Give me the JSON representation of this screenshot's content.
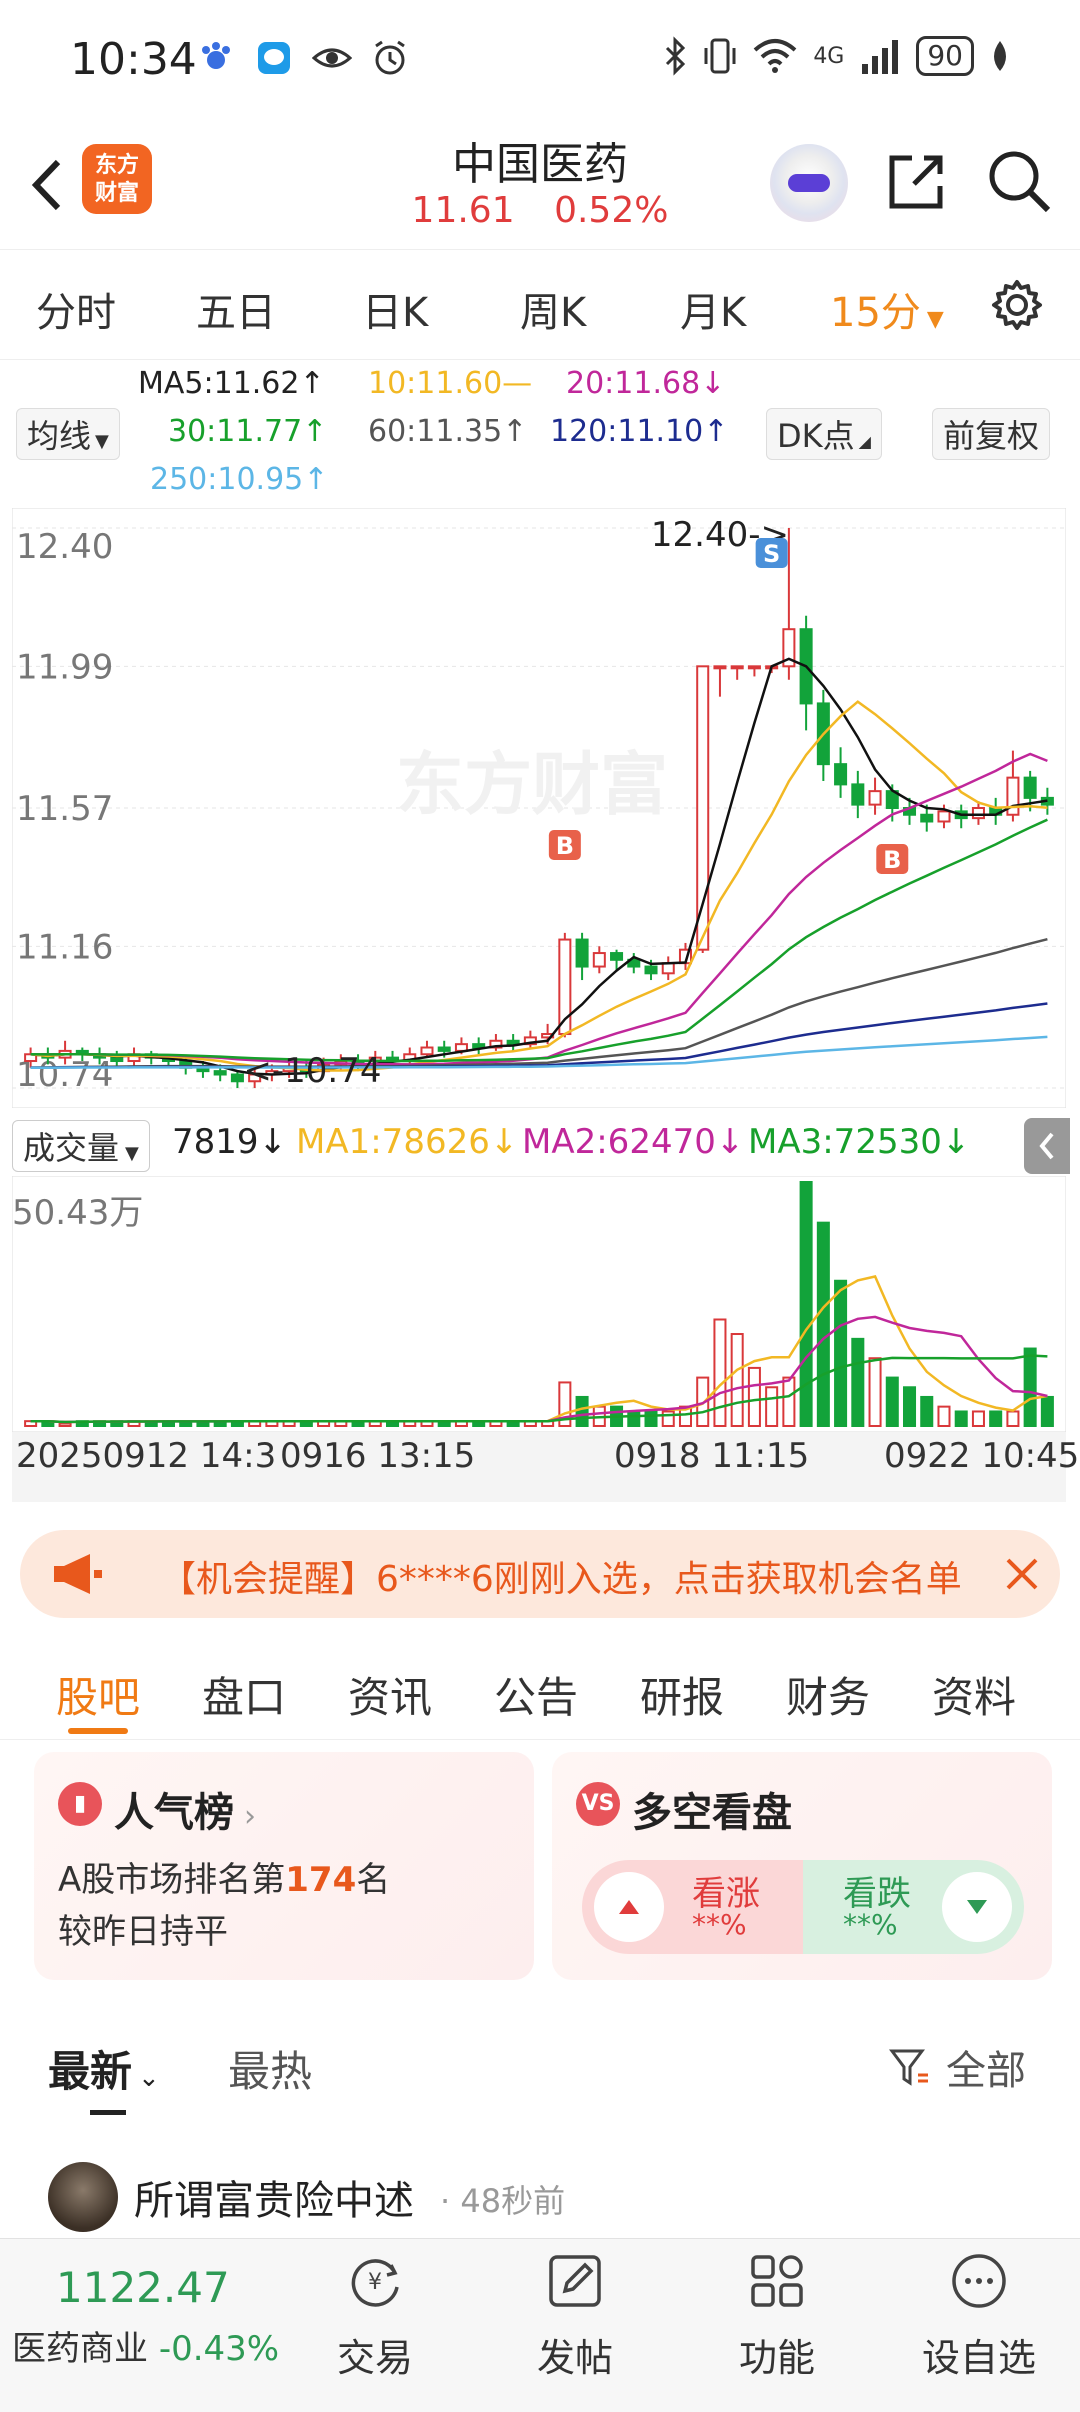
{
  "status_bar": {
    "time": "10:34",
    "network": "4G",
    "battery": "90"
  },
  "header": {
    "logo_text_top": "东方",
    "logo_text_bottom": "财富",
    "stock_name": "中国医药",
    "price": "11.61",
    "change_pct": "0.52%"
  },
  "period_tabs": [
    {
      "label": "分时"
    },
    {
      "label": "五日"
    },
    {
      "label": "日K"
    },
    {
      "label": "周K"
    },
    {
      "label": "月K"
    },
    {
      "label": "15分",
      "active": true
    }
  ],
  "ma_legend": {
    "indicator_select": "均线",
    "ma5": "MA5:11.62↑",
    "ma10": "10:11.60—",
    "ma20": "20:11.68↓",
    "ma30": "30:11.77↑",
    "ma60": "60:11.35↑",
    "ma120": "120:11.10↑",
    "ma250": "250:10.95↑",
    "dk_button": "DK点",
    "adjust_button": "前复权"
  },
  "chart_data": {
    "type": "candlestick",
    "watermark": "东方财富",
    "y_ticks": [
      "12.40",
      "11.99",
      "11.57",
      "11.16",
      "10.74"
    ],
    "ylim": [
      10.74,
      12.4
    ],
    "high_label": "12.40->",
    "low_label": "<-10.74",
    "markers": [
      "S",
      "B",
      "B"
    ],
    "colors": {
      "up": "#d9383a",
      "down": "#12a33a",
      "ma5": "#111111",
      "ma10": "#f2b824",
      "ma20": "#c0279a",
      "ma30": "#17a02b",
      "ma60": "#555555",
      "ma120": "#1d2c8f",
      "ma250": "#5cb6e6"
    },
    "candles": [
      [
        10.82,
        10.84,
        10.8,
        10.86
      ],
      [
        10.84,
        10.83,
        10.81,
        10.86
      ],
      [
        10.83,
        10.85,
        10.81,
        10.88
      ],
      [
        10.85,
        10.84,
        10.82,
        10.86
      ],
      [
        10.84,
        10.83,
        10.81,
        10.86
      ],
      [
        10.83,
        10.82,
        10.8,
        10.85
      ],
      [
        10.82,
        10.84,
        10.8,
        10.86
      ],
      [
        10.84,
        10.83,
        10.81,
        10.85
      ],
      [
        10.83,
        10.82,
        10.8,
        10.84
      ],
      [
        10.82,
        10.8,
        10.78,
        10.83
      ],
      [
        10.8,
        10.79,
        10.77,
        10.82
      ],
      [
        10.79,
        10.78,
        10.76,
        10.81
      ],
      [
        10.78,
        10.76,
        10.74,
        10.79
      ],
      [
        10.76,
        10.78,
        10.74,
        10.8
      ],
      [
        10.78,
        10.79,
        10.76,
        10.81
      ],
      [
        10.79,
        10.8,
        10.77,
        10.82
      ],
      [
        10.8,
        10.79,
        10.77,
        10.82
      ],
      [
        10.79,
        10.81,
        10.78,
        10.83
      ],
      [
        10.81,
        10.82,
        10.79,
        10.84
      ],
      [
        10.82,
        10.81,
        10.79,
        10.84
      ],
      [
        10.81,
        10.83,
        10.8,
        10.85
      ],
      [
        10.83,
        10.82,
        10.8,
        10.85
      ],
      [
        10.82,
        10.84,
        10.81,
        10.86
      ],
      [
        10.84,
        10.86,
        10.83,
        10.88
      ],
      [
        10.86,
        10.85,
        10.83,
        10.88
      ],
      [
        10.85,
        10.87,
        10.84,
        10.89
      ],
      [
        10.87,
        10.86,
        10.84,
        10.89
      ],
      [
        10.86,
        10.88,
        10.85,
        10.9
      ],
      [
        10.88,
        10.87,
        10.85,
        10.9
      ],
      [
        10.87,
        10.89,
        10.86,
        10.91
      ],
      [
        10.89,
        10.9,
        10.87,
        10.93
      ],
      [
        10.9,
        11.18,
        10.89,
        11.2
      ],
      [
        11.18,
        11.1,
        11.06,
        11.2
      ],
      [
        11.1,
        11.14,
        11.08,
        11.16
      ],
      [
        11.14,
        11.12,
        11.09,
        11.15
      ],
      [
        11.12,
        11.1,
        11.08,
        11.14
      ],
      [
        11.1,
        11.08,
        11.06,
        11.12
      ],
      [
        11.08,
        11.11,
        11.06,
        11.13
      ],
      [
        11.11,
        11.15,
        11.09,
        11.17
      ],
      [
        11.15,
        11.99,
        11.14,
        11.99
      ],
      [
        11.99,
        11.99,
        11.9,
        11.99
      ],
      [
        11.99,
        11.99,
        11.95,
        11.99
      ],
      [
        11.99,
        11.99,
        11.96,
        11.99
      ],
      [
        11.99,
        11.99,
        11.97,
        11.99
      ],
      [
        11.99,
        12.1,
        11.95,
        12.4
      ],
      [
        12.1,
        11.88,
        11.8,
        12.14
      ],
      [
        11.88,
        11.7,
        11.65,
        11.92
      ],
      [
        11.7,
        11.64,
        11.6,
        11.75
      ],
      [
        11.64,
        11.58,
        11.54,
        11.68
      ],
      [
        11.58,
        11.62,
        11.55,
        11.66
      ],
      [
        11.62,
        11.57,
        11.53,
        11.64
      ],
      [
        11.57,
        11.55,
        11.52,
        11.6
      ],
      [
        11.55,
        11.53,
        11.5,
        11.58
      ],
      [
        11.53,
        11.56,
        11.51,
        11.58
      ],
      [
        11.56,
        11.54,
        11.51,
        11.58
      ],
      [
        11.54,
        11.57,
        11.52,
        11.59
      ],
      [
        11.57,
        11.55,
        11.52,
        11.6
      ],
      [
        11.55,
        11.66,
        11.53,
        11.74
      ],
      [
        11.66,
        11.6,
        11.56,
        11.68
      ],
      [
        11.6,
        11.58,
        11.55,
        11.63
      ]
    ]
  },
  "volume_bar": {
    "selector": "成交量",
    "current": "7819↓",
    "ma1": "MA1:78626↓",
    "ma2": "MA2:62470↓",
    "ma3": "MA3:72530↓",
    "max_label": "50.43万"
  },
  "volume_data": {
    "values": [
      1,
      1,
      0.5,
      1,
      1,
      1,
      1,
      1,
      1,
      1,
      1,
      1,
      1,
      1,
      1,
      1,
      1,
      1,
      1,
      1,
      1,
      1,
      1,
      1,
      1,
      1,
      1,
      1,
      1,
      1,
      1,
      9,
      6,
      4,
      4,
      3,
      3,
      3,
      4,
      10,
      22,
      19,
      12,
      8,
      10,
      50.4,
      42,
      30,
      18,
      14,
      10,
      8,
      6,
      4,
      3,
      3,
      3,
      3,
      16,
      6
    ]
  },
  "x_labels": [
    "20250912 14:30",
    "0916 13:15",
    "0918 11:15",
    "0922 10:45"
  ],
  "notice": {
    "text": "【机会提醒】6****6刚刚入选，点击获取机会名单"
  },
  "content_tabs": [
    {
      "label": "股吧",
      "active": true
    },
    {
      "label": "盘口"
    },
    {
      "label": "资讯"
    },
    {
      "label": "公告"
    },
    {
      "label": "研报"
    },
    {
      "label": "财务"
    },
    {
      "label": "资料"
    }
  ],
  "popularity_card": {
    "title": "人气榜",
    "line1_prefix": "A股市场排名第",
    "rank": "174",
    "line1_suffix": "名",
    "line2": "较昨日持平"
  },
  "sentiment_card": {
    "title": "多空看盘",
    "up_label": "看涨",
    "up_pct": "**%",
    "down_label": "看跌",
    "down_pct": "**%"
  },
  "sort_row": {
    "latest": "最新",
    "hottest": "最热",
    "filter": "全部"
  },
  "post": {
    "username": "所谓富贵险中述",
    "time": "· 48秒前"
  },
  "bottom_bar": {
    "index_value": "1122.47",
    "index_name": "医药商业",
    "index_change": "-0.43%",
    "items": [
      {
        "label": "交易"
      },
      {
        "label": "发帖"
      },
      {
        "label": "功能"
      },
      {
        "label": "设自选"
      }
    ]
  }
}
